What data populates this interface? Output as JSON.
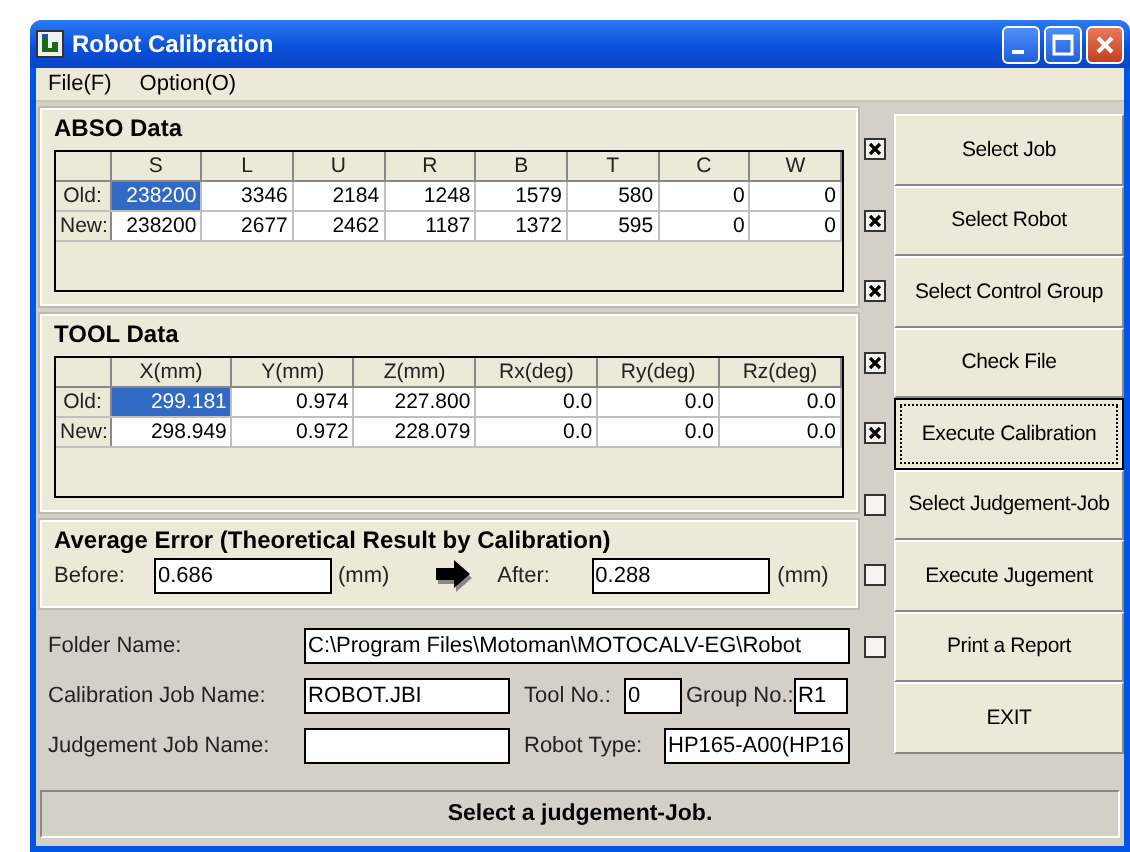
{
  "window": {
    "title": "Robot Calibration"
  },
  "menu": [
    "File(F)",
    "Option(O)"
  ],
  "abso": {
    "title": "ABSO Data",
    "columns": [
      "S",
      "L",
      "U",
      "R",
      "B",
      "T",
      "C",
      "W"
    ],
    "rows": [
      {
        "label": "Old:",
        "cells": [
          {
            "value": "238200",
            "selected": true
          },
          {
            "value": "3346",
            "selected": false
          },
          {
            "value": "2184",
            "selected": false
          },
          {
            "value": "1248",
            "selected": false
          },
          {
            "value": "1579",
            "selected": false
          },
          {
            "value": "580",
            "selected": false
          },
          {
            "value": "0",
            "selected": false
          },
          {
            "value": "0",
            "selected": false
          }
        ]
      },
      {
        "label": "New:",
        "cells": [
          {
            "value": "238200",
            "selected": false
          },
          {
            "value": "2677",
            "selected": false
          },
          {
            "value": "2462",
            "selected": false
          },
          {
            "value": "1187",
            "selected": false
          },
          {
            "value": "1372",
            "selected": false
          },
          {
            "value": "595",
            "selected": false
          },
          {
            "value": "0",
            "selected": false
          },
          {
            "value": "0",
            "selected": false
          }
        ]
      }
    ]
  },
  "tool": {
    "title": "TOOL Data",
    "columns": [
      "X(mm)",
      "Y(mm)",
      "Z(mm)",
      "Rx(deg)",
      "Ry(deg)",
      "Rz(deg)"
    ],
    "rows": [
      {
        "label": "Old:",
        "cells": [
          {
            "value": "299.181",
            "selected": true
          },
          {
            "value": "0.974",
            "selected": false
          },
          {
            "value": "227.800",
            "selected": false
          },
          {
            "value": "0.0",
            "selected": false
          },
          {
            "value": "0.0",
            "selected": false
          },
          {
            "value": "0.0",
            "selected": false
          }
        ]
      },
      {
        "label": "New:",
        "cells": [
          {
            "value": "298.949",
            "selected": false
          },
          {
            "value": "0.972",
            "selected": false
          },
          {
            "value": "228.079",
            "selected": false
          },
          {
            "value": "0.0",
            "selected": false
          },
          {
            "value": "0.0",
            "selected": false
          },
          {
            "value": "0.0",
            "selected": false
          }
        ]
      }
    ]
  },
  "average_error": {
    "title": "Average Error (Theoretical Result by Calibration)",
    "before_label": "Before:",
    "before_value": "0.686",
    "before_unit": "(mm)",
    "after_label": "After:",
    "after_value": "0.288",
    "after_unit": "(mm)"
  },
  "fields": {
    "folder_name": {
      "label": "Folder Name:",
      "value": "C:\\Program Files\\Motoman\\MOTOCALV-EG\\Robot"
    },
    "calibration_job": {
      "label": "Calibration Job Name:",
      "value": "ROBOT.JBI"
    },
    "tool_no": {
      "label": "Tool No.:",
      "value": "0"
    },
    "group_no": {
      "label": "Group No.:",
      "value": "R1"
    },
    "judgement_job": {
      "label": "Judgement Job Name:"
    },
    "robot_type": {
      "label": "Robot Type:",
      "value": "HP165-A00(HP16"
    }
  },
  "steps": [
    {
      "kind": "step",
      "label": "Select Job",
      "checked": true,
      "focused": false
    },
    {
      "kind": "step",
      "label": "Select Robot",
      "checked": true,
      "focused": false
    },
    {
      "kind": "step",
      "label": "Select Control Group",
      "checked": true,
      "focused": false
    },
    {
      "kind": "step",
      "label": "Check File",
      "checked": true,
      "focused": false
    },
    {
      "kind": "step",
      "label": "Execute Calibration",
      "checked": true,
      "focused": true
    },
    {
      "kind": "step",
      "label": "Select Judgement-Job",
      "checked": false,
      "focused": false
    },
    {
      "kind": "step",
      "label": "Execute Jugement",
      "checked": false,
      "focused": false
    },
    {
      "kind": "step",
      "label": "Print a Report",
      "checked": false,
      "focused": false
    },
    {
      "kind": "plain",
      "label": "EXIT",
      "focused": false
    }
  ],
  "status_bar": "Select a judgement-Job."
}
